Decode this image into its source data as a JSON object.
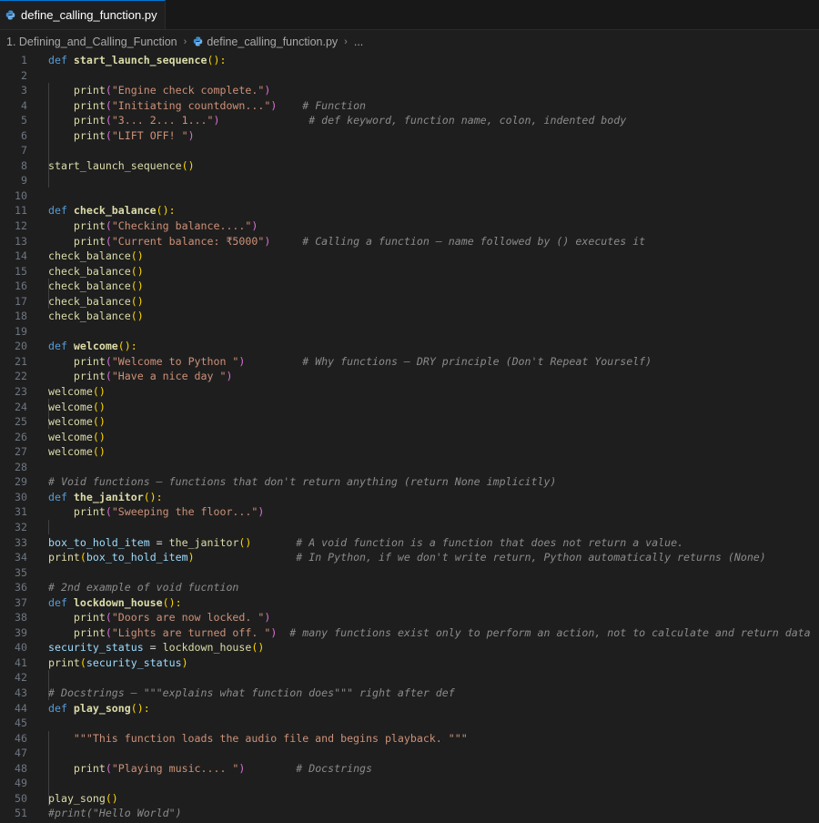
{
  "tab": {
    "filename": "define_calling_function.py"
  },
  "breadcrumb": {
    "folder": "1. Defining_and_Calling_Function",
    "file": "define_calling_function.py",
    "more": "..."
  },
  "lines": [
    [
      [
        "kw",
        "def "
      ],
      [
        "fn",
        "start_launch_sequence"
      ],
      [
        "paren",
        "():"
      ]
    ],
    [],
    [
      [
        "sp",
        "    "
      ],
      [
        "call",
        "print"
      ],
      [
        "paren2",
        "("
      ],
      [
        "str",
        "\"Engine check complete.\""
      ],
      [
        "paren2",
        ")"
      ]
    ],
    [
      [
        "sp",
        "    "
      ],
      [
        "call",
        "print"
      ],
      [
        "paren2",
        "("
      ],
      [
        "str",
        "\"Initiating countdown...\""
      ],
      [
        "paren2",
        ")"
      ],
      [
        "sp",
        "    "
      ],
      [
        "cm",
        "# Function"
      ]
    ],
    [
      [
        "sp",
        "    "
      ],
      [
        "call",
        "print"
      ],
      [
        "paren2",
        "("
      ],
      [
        "str",
        "\"3... 2... 1...\""
      ],
      [
        "paren2",
        ")"
      ],
      [
        "sp",
        "              "
      ],
      [
        "cm",
        "# def keyword, function name, colon, indented body"
      ]
    ],
    [
      [
        "sp",
        "    "
      ],
      [
        "call",
        "print"
      ],
      [
        "paren2",
        "("
      ],
      [
        "str",
        "\"LIFT OFF! \""
      ],
      [
        "paren2",
        ")"
      ]
    ],
    [],
    [
      [
        "call",
        "start_launch_sequence"
      ],
      [
        "paren",
        "()"
      ]
    ],
    [],
    [],
    [
      [
        "kw",
        "def "
      ],
      [
        "fn",
        "check_balance"
      ],
      [
        "paren",
        "():"
      ]
    ],
    [
      [
        "sp",
        "    "
      ],
      [
        "call",
        "print"
      ],
      [
        "paren2",
        "("
      ],
      [
        "str",
        "\"Checking balance....\""
      ],
      [
        "paren2",
        ")"
      ]
    ],
    [
      [
        "sp",
        "    "
      ],
      [
        "call",
        "print"
      ],
      [
        "paren2",
        "("
      ],
      [
        "str",
        "\"Current balance: ₹5000\""
      ],
      [
        "paren2",
        ")"
      ],
      [
        "sp",
        "     "
      ],
      [
        "cm",
        "# Calling a function – name followed by () executes it"
      ]
    ],
    [
      [
        "call",
        "check_balance"
      ],
      [
        "paren",
        "()"
      ]
    ],
    [
      [
        "call",
        "check_balance"
      ],
      [
        "paren",
        "()"
      ]
    ],
    [
      [
        "call",
        "check_balance"
      ],
      [
        "paren",
        "()"
      ]
    ],
    [
      [
        "call",
        "check_balance"
      ],
      [
        "paren",
        "()"
      ]
    ],
    [
      [
        "call",
        "check_balance"
      ],
      [
        "paren",
        "()"
      ]
    ],
    [],
    [
      [
        "kw",
        "def "
      ],
      [
        "fn",
        "welcome"
      ],
      [
        "paren",
        "():"
      ]
    ],
    [
      [
        "sp",
        "    "
      ],
      [
        "call",
        "print"
      ],
      [
        "paren2",
        "("
      ],
      [
        "str",
        "\"Welcome to Python \""
      ],
      [
        "paren2",
        ")"
      ],
      [
        "sp",
        "         "
      ],
      [
        "cm",
        "# Why functions – DRY principle (Don't Repeat Yourself)"
      ]
    ],
    [
      [
        "sp",
        "    "
      ],
      [
        "call",
        "print"
      ],
      [
        "paren2",
        "("
      ],
      [
        "str",
        "\"Have a nice day \""
      ],
      [
        "paren2",
        ")"
      ]
    ],
    [
      [
        "call",
        "welcome"
      ],
      [
        "paren",
        "()"
      ]
    ],
    [
      [
        "call",
        "welcome"
      ],
      [
        "paren",
        "()"
      ]
    ],
    [
      [
        "call",
        "welcome"
      ],
      [
        "paren",
        "()"
      ]
    ],
    [
      [
        "call",
        "welcome"
      ],
      [
        "paren",
        "()"
      ]
    ],
    [
      [
        "call",
        "welcome"
      ],
      [
        "paren",
        "()"
      ]
    ],
    [],
    [
      [
        "cm",
        "# Void functions – functions that don't return anything (return None implicitly)"
      ]
    ],
    [
      [
        "kw",
        "def "
      ],
      [
        "fn",
        "the_janitor"
      ],
      [
        "paren",
        "():"
      ]
    ],
    [
      [
        "sp",
        "    "
      ],
      [
        "call",
        "print"
      ],
      [
        "paren2",
        "("
      ],
      [
        "str",
        "\"Sweeping the floor...\""
      ],
      [
        "paren2",
        ")"
      ]
    ],
    [],
    [
      [
        "var",
        "box_to_hold_item"
      ],
      [
        "op",
        " = "
      ],
      [
        "call",
        "the_janitor"
      ],
      [
        "paren",
        "()"
      ],
      [
        "sp",
        "       "
      ],
      [
        "cm",
        "# A void function is a function that does not return a value."
      ]
    ],
    [
      [
        "call",
        "print"
      ],
      [
        "paren",
        "("
      ],
      [
        "var",
        "box_to_hold_item"
      ],
      [
        "paren",
        ")"
      ],
      [
        "sp",
        "                "
      ],
      [
        "cm",
        "# In Python, if we don't write return, Python automatically returns (None)"
      ]
    ],
    [],
    [
      [
        "cm",
        "# 2nd example of void fucntion"
      ]
    ],
    [
      [
        "kw",
        "def "
      ],
      [
        "fn",
        "lockdown_house"
      ],
      [
        "paren",
        "():"
      ]
    ],
    [
      [
        "sp",
        "    "
      ],
      [
        "call",
        "print"
      ],
      [
        "paren2",
        "("
      ],
      [
        "str",
        "\"Doors are now locked. \""
      ],
      [
        "paren2",
        ")"
      ]
    ],
    [
      [
        "sp",
        "    "
      ],
      [
        "call",
        "print"
      ],
      [
        "paren2",
        "("
      ],
      [
        "str",
        "\"Lights are turned off. \""
      ],
      [
        "paren2",
        ")"
      ],
      [
        "sp",
        "  "
      ],
      [
        "cm",
        "# many functions exist only to perform an action, not to calculate and return data"
      ]
    ],
    [
      [
        "var",
        "security_status"
      ],
      [
        "op",
        " = "
      ],
      [
        "call",
        "lockdown_house"
      ],
      [
        "paren",
        "()"
      ]
    ],
    [
      [
        "call",
        "print"
      ],
      [
        "paren",
        "("
      ],
      [
        "var",
        "security_status"
      ],
      [
        "paren",
        ")"
      ]
    ],
    [],
    [
      [
        "cm",
        "# Docstrings – \"\"\"explains what function does\"\"\" right after def"
      ]
    ],
    [
      [
        "kw",
        "def "
      ],
      [
        "fn",
        "play_song"
      ],
      [
        "paren",
        "():"
      ]
    ],
    [],
    [
      [
        "sp",
        "    "
      ],
      [
        "str",
        "\"\"\"This function loads the audio file and begins playback. \"\"\""
      ]
    ],
    [],
    [
      [
        "sp",
        "    "
      ],
      [
        "call",
        "print"
      ],
      [
        "paren2",
        "("
      ],
      [
        "str",
        "\"Playing music.... \""
      ],
      [
        "paren2",
        ")"
      ],
      [
        "sp",
        "        "
      ],
      [
        "cm",
        "# Docstrings"
      ]
    ],
    [],
    [
      [
        "call",
        "play_song"
      ],
      [
        "paren",
        "()"
      ]
    ],
    [
      [
        "cm",
        "#print(\"Hello World\")"
      ]
    ]
  ]
}
